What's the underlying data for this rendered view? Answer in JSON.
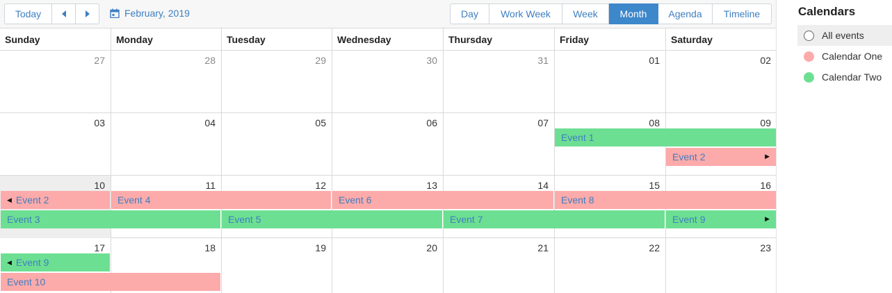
{
  "toolbar": {
    "today_label": "Today",
    "prev_icon": "◀",
    "next_icon": "▶",
    "date_label": "February, 2019",
    "views": [
      {
        "label": "Day",
        "active": false
      },
      {
        "label": "Work Week",
        "active": false
      },
      {
        "label": "Week",
        "active": false
      },
      {
        "label": "Month",
        "active": true
      },
      {
        "label": "Agenda",
        "active": false
      },
      {
        "label": "Timeline",
        "active": false
      }
    ]
  },
  "weekdays": [
    "Sunday",
    "Monday",
    "Tuesday",
    "Wednesday",
    "Thursday",
    "Friday",
    "Saturday"
  ],
  "weeks": [
    [
      {
        "n": "27",
        "other": true
      },
      {
        "n": "28",
        "other": true
      },
      {
        "n": "29",
        "other": true
      },
      {
        "n": "30",
        "other": true
      },
      {
        "n": "31",
        "other": true
      },
      {
        "n": "01"
      },
      {
        "n": "02"
      }
    ],
    [
      {
        "n": "03"
      },
      {
        "n": "04"
      },
      {
        "n": "05"
      },
      {
        "n": "06"
      },
      {
        "n": "07"
      },
      {
        "n": "08"
      },
      {
        "n": "09"
      }
    ],
    [
      {
        "n": "10",
        "today": true
      },
      {
        "n": "11"
      },
      {
        "n": "12"
      },
      {
        "n": "13"
      },
      {
        "n": "14"
      },
      {
        "n": "15"
      },
      {
        "n": "16"
      }
    ],
    [
      {
        "n": "17"
      },
      {
        "n": "18"
      },
      {
        "n": "19"
      },
      {
        "n": "20"
      },
      {
        "n": "21"
      },
      {
        "n": "22"
      },
      {
        "n": "23"
      }
    ]
  ],
  "events": [
    {
      "label": "Event 1",
      "calendar": "two",
      "week": 1,
      "start": 5,
      "span": 2,
      "row": 0
    },
    {
      "label": "Event 2",
      "calendar": "one",
      "week": 1,
      "start": 6,
      "span": 1,
      "row": 1,
      "continues": true
    },
    {
      "label": "Event 2",
      "calendar": "one",
      "week": 2,
      "start": 0,
      "span": 1,
      "row": 0,
      "continued": true
    },
    {
      "label": "Event 4",
      "calendar": "one",
      "week": 2,
      "start": 1,
      "span": 2,
      "row": 0
    },
    {
      "label": "Event 6",
      "calendar": "one",
      "week": 2,
      "start": 3,
      "span": 2,
      "row": 0
    },
    {
      "label": "Event 8",
      "calendar": "one",
      "week": 2,
      "start": 5,
      "span": 2,
      "row": 0
    },
    {
      "label": "Event 3",
      "calendar": "two",
      "week": 2,
      "start": 0,
      "span": 2,
      "row": 1
    },
    {
      "label": "Event 5",
      "calendar": "two",
      "week": 2,
      "start": 2,
      "span": 2,
      "row": 1
    },
    {
      "label": "Event 7",
      "calendar": "two",
      "week": 2,
      "start": 4,
      "span": 2,
      "row": 1
    },
    {
      "label": "Event 9",
      "calendar": "two",
      "week": 2,
      "start": 6,
      "span": 1,
      "row": 1,
      "continues": true
    },
    {
      "label": "Event 9",
      "calendar": "two",
      "week": 3,
      "start": 0,
      "span": 1,
      "row": 0,
      "continued": true
    },
    {
      "label": "Event 10",
      "calendar": "one",
      "week": 3,
      "start": 0,
      "span": 2,
      "row": 1
    }
  ],
  "sidebar": {
    "title": "Calendars",
    "items": [
      {
        "label": "All events",
        "icon": "radio-ring",
        "selected": true
      },
      {
        "label": "Calendar One",
        "color": "#fdaaaa"
      },
      {
        "label": "Calendar Two",
        "color": "#6ddf92"
      }
    ]
  },
  "colors": {
    "accent": "#3e7fc1",
    "active_view": "#3d87cb",
    "calendar_one": "#fdaaaa",
    "calendar_two": "#6ddf92",
    "today_cell": "#eeeeee"
  }
}
